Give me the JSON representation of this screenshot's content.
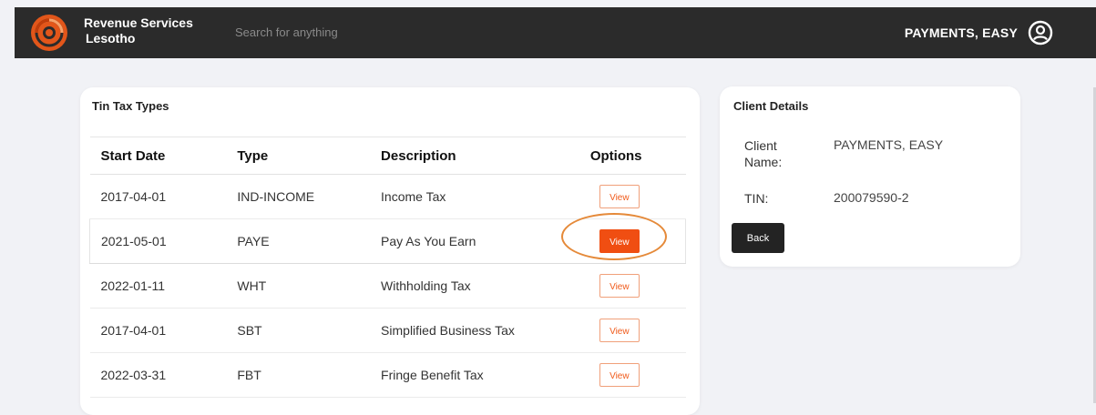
{
  "header": {
    "brand_line1": "Revenue Services",
    "brand_line2": "Lesotho",
    "search_placeholder": "Search for anything",
    "username": "PAYMENTS, EASY",
    "logo_icon": "rsl-logo-icon",
    "user_icon": "user-circle-icon"
  },
  "tax_types": {
    "title": "Tin Tax Types",
    "columns": [
      "Start Date",
      "Type",
      "Description",
      "Options"
    ],
    "rows": [
      {
        "start_date": "2017-04-01",
        "type": "IND-INCOME",
        "description": "Income Tax",
        "action": "View"
      },
      {
        "start_date": "2021-05-01",
        "type": "PAYE",
        "description": "Pay As You Earn",
        "action": "View"
      },
      {
        "start_date": "2022-01-11",
        "type": "WHT",
        "description": "Withholding Tax",
        "action": "View"
      },
      {
        "start_date": "2017-04-01",
        "type": "SBT",
        "description": "Simplified Business Tax",
        "action": "View"
      },
      {
        "start_date": "2022-03-31",
        "type": "FBT",
        "description": "Fringe Benefit Tax",
        "action": "View"
      }
    ]
  },
  "client_details": {
    "title": "Client Details",
    "name_label_line1": "Client",
    "name_label_line2": "Name:",
    "name_value": "PAYMENTS, EASY",
    "tin_label": "TIN:",
    "tin_value": "200079590-2",
    "back_label": "Back"
  },
  "colors": {
    "accent": "#f04e12",
    "topbar": "#2b2b2b",
    "background": "#f1f2f6",
    "annotation": "#e58a3a"
  }
}
